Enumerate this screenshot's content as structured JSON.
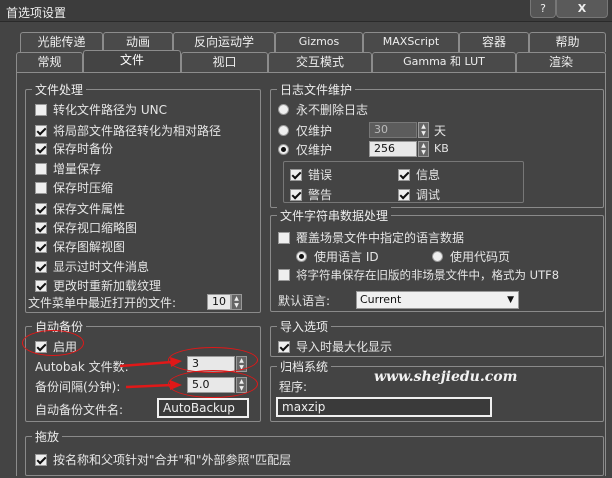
{
  "window": {
    "title": "首选项设置",
    "help_label": "?",
    "close_label": "X"
  },
  "tabs_row1": [
    "光能传递",
    "动画",
    "反向运动学",
    "Gizmos",
    "MAXScript",
    "容器",
    "帮助"
  ],
  "tabs_row2": [
    "常规",
    "文件",
    "视口",
    "交互模式",
    "Gamma 和 LUT",
    "渲染"
  ],
  "active_tab": "文件",
  "file_handling": {
    "title": "文件处理",
    "options": [
      {
        "label": "转化文件路径为 UNC",
        "checked": false
      },
      {
        "label": "将局部文件路径转化为相对路径",
        "checked": true
      },
      {
        "label": "保存时备份",
        "checked": true
      },
      {
        "label": "增量保存",
        "checked": false
      },
      {
        "label": "保存时压缩",
        "checked": false
      },
      {
        "label": "保存文件属性",
        "checked": true
      },
      {
        "label": "保存视口缩略图",
        "checked": true
      },
      {
        "label": "保存图解视图",
        "checked": true
      },
      {
        "label": "显示过时文件消息",
        "checked": true
      },
      {
        "label": "更改时重新加载纹理",
        "checked": true
      }
    ],
    "recent_label": "文件菜单中最近打开的文件:",
    "recent_value": "10"
  },
  "log": {
    "title": "日志文件维护",
    "never_delete": "永不删除日志",
    "keep_days_label": "仅维护",
    "keep_days_value": "30",
    "keep_days_unit": "天",
    "keep_kb_label": "仅维护",
    "keep_kb_value": "256",
    "keep_kb_unit": "KB",
    "selected": "kb",
    "flags": [
      {
        "label": "错误",
        "checked": true
      },
      {
        "label": "信息",
        "checked": true
      },
      {
        "label": "警告",
        "checked": true
      },
      {
        "label": "调试",
        "checked": true
      }
    ]
  },
  "string_data": {
    "title": "文件字符串数据处理",
    "override": {
      "label": "覆盖场景文件中指定的语言数据",
      "checked": false
    },
    "use_lang_id": "使用语言 ID",
    "use_codepage": "使用代码页",
    "save_old": {
      "label": "将字符串保存在旧版的非场景文件中，格式为 UTF8",
      "checked": false
    },
    "default_lang_label": "默认语言:",
    "default_lang_value": "Current"
  },
  "autobackup": {
    "title": "自动备份",
    "enable": {
      "label": "启用",
      "checked": true
    },
    "count_label": "Autobak 文件数:",
    "count_value": "3",
    "interval_label": "备份间隔(分钟):",
    "interval_value": "5.0",
    "name_label": "自动备份文件名:",
    "name_value": "AutoBackup"
  },
  "import": {
    "title": "导入选项",
    "maximize": {
      "label": "导入时最大化显示",
      "checked": true
    }
  },
  "archive": {
    "title": "归档系统",
    "program_label": "程序:",
    "program_value": "maxzip"
  },
  "watermark": "www.shejiedu.com",
  "dragdrop": {
    "title": "拖放",
    "match": {
      "label": "按名称和父项针对\"合并\"和\"外部参照\"匹配层",
      "checked": true
    }
  },
  "colors": {
    "annotation": "#e01818",
    "background": "#444444"
  }
}
